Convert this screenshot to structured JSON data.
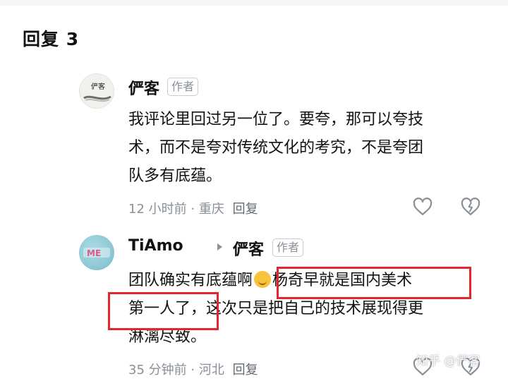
{
  "section": {
    "title": "回复 3"
  },
  "comments": [
    {
      "author": "俨客",
      "badge": "作者",
      "avatar_text": "俨客",
      "text_lines": [
        "我评论里回过另一位了。要夸，那可以夸技",
        "术，而不是夸对传统文化的考究，不是夸团",
        "队多有底蕴。"
      ],
      "time": "12 小时前",
      "location": "重庆",
      "reply_label": "回复"
    },
    {
      "author": "TiAmo",
      "reply_to": "俨客",
      "badge": "作者",
      "avatar_text": "ME",
      "text_lines": [
        "团队确实有底蕴啊",
        "杨奇早就是国内美术",
        "第一人了，",
        "这次只是把自己的技术展现得更",
        "淋漓尽致。"
      ],
      "time": "35 分钟前",
      "location": "河北",
      "reply_label": "回复"
    }
  ],
  "watermark": "知乎 @俨客",
  "colors": {
    "highlight_box": "#e0262f",
    "meta": "#8a8f99"
  },
  "icons": [
    "heart-icon",
    "broken-heart-icon",
    "arrow-right-icon",
    "smile-emoji-icon"
  ]
}
